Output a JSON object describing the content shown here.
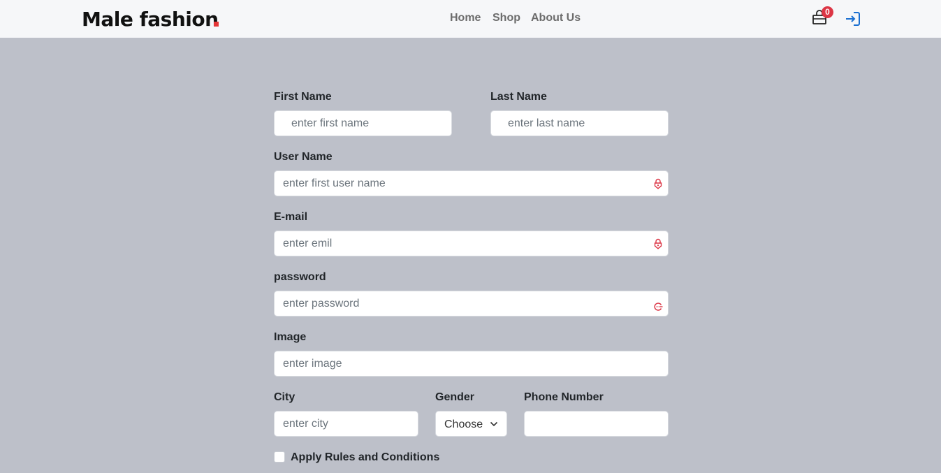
{
  "navbar": {
    "logo_text": "Male fashion",
    "links": [
      "Home",
      "Shop",
      "About Us"
    ],
    "cart_count": "0",
    "icons": {
      "cart": "shopping-bag-icon",
      "login": "login-arrow-icon"
    },
    "accent_color": "#e53637",
    "login_color": "#1a6fd1"
  },
  "form": {
    "first_name": {
      "label": "First Name",
      "placeholder": "enter first name"
    },
    "last_name": {
      "label": "Last Name",
      "placeholder": "enter last name"
    },
    "user_name": {
      "label": "User Name",
      "placeholder": "enter first user name"
    },
    "email": {
      "label": "E-mail",
      "placeholder": "enter emil"
    },
    "password": {
      "label": "password",
      "placeholder": "enter password"
    },
    "image": {
      "label": "Image",
      "placeholder": "enter image"
    },
    "city": {
      "label": "City",
      "placeholder": "enter city"
    },
    "gender": {
      "label": "Gender",
      "selected": "Choose"
    },
    "phone": {
      "label": "Phone Number",
      "placeholder": ""
    },
    "rules": {
      "label": "Apply Rules and Conditions",
      "checked": false
    },
    "invalid_color": "#dc3545"
  }
}
